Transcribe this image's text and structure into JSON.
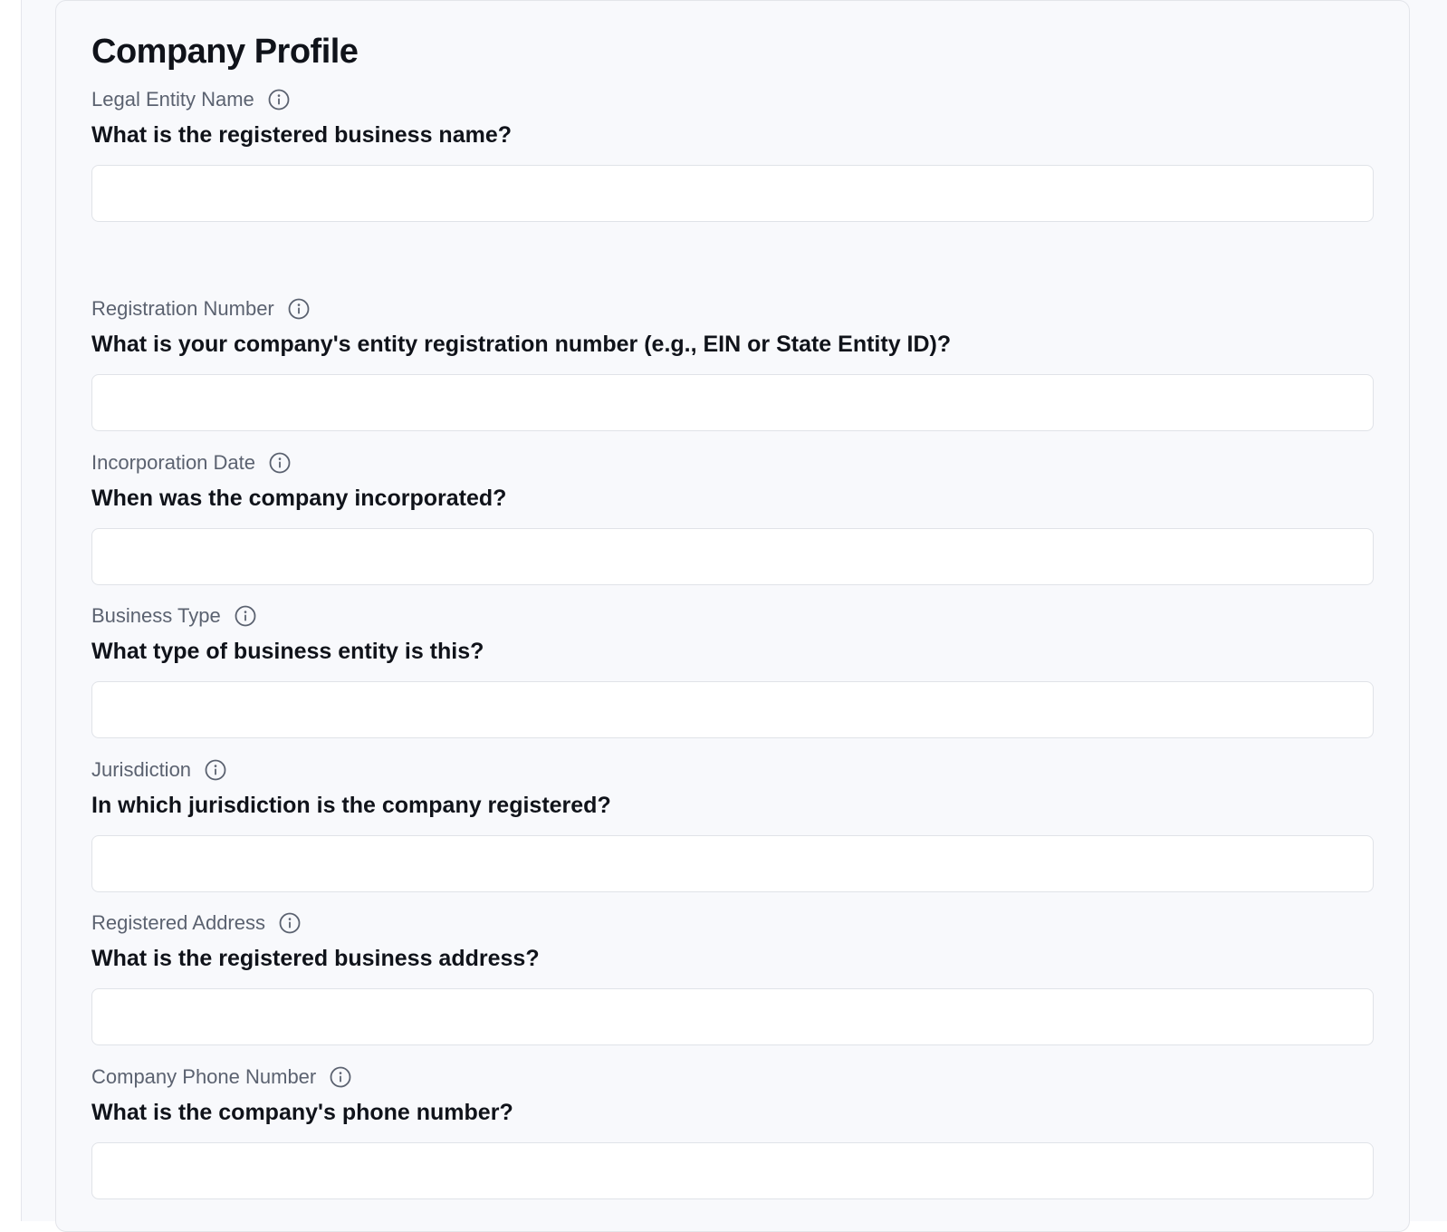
{
  "form": {
    "title": "Company Profile",
    "fields": [
      {
        "label": "Legal Entity Name",
        "question": "What is the registered business name?",
        "value": "",
        "icon": "info-icon"
      },
      {
        "label": "Registration Number",
        "question": "What is your company's entity registration number (e.g., EIN or State Entity ID)?",
        "value": "",
        "icon": "info-icon"
      },
      {
        "label": "Incorporation Date",
        "question": "When was the company incorporated?",
        "value": "",
        "icon": "info-icon"
      },
      {
        "label": "Business Type",
        "question": "What type of business entity is this?",
        "value": "",
        "icon": "info-icon"
      },
      {
        "label": "Jurisdiction",
        "question": "In which jurisdiction is the company registered?",
        "value": "",
        "icon": "info-icon"
      },
      {
        "label": "Registered Address",
        "question": "What is the registered business address?",
        "value": "",
        "icon": "info-icon"
      },
      {
        "label": "Company Phone Number",
        "question": "What is the company's phone number?",
        "value": "",
        "icon": "info-icon"
      }
    ]
  },
  "colors": {
    "background": "#f8f9fc",
    "label": "#5b6270",
    "question": "#10131a",
    "input_border": "#e0e3e8"
  }
}
